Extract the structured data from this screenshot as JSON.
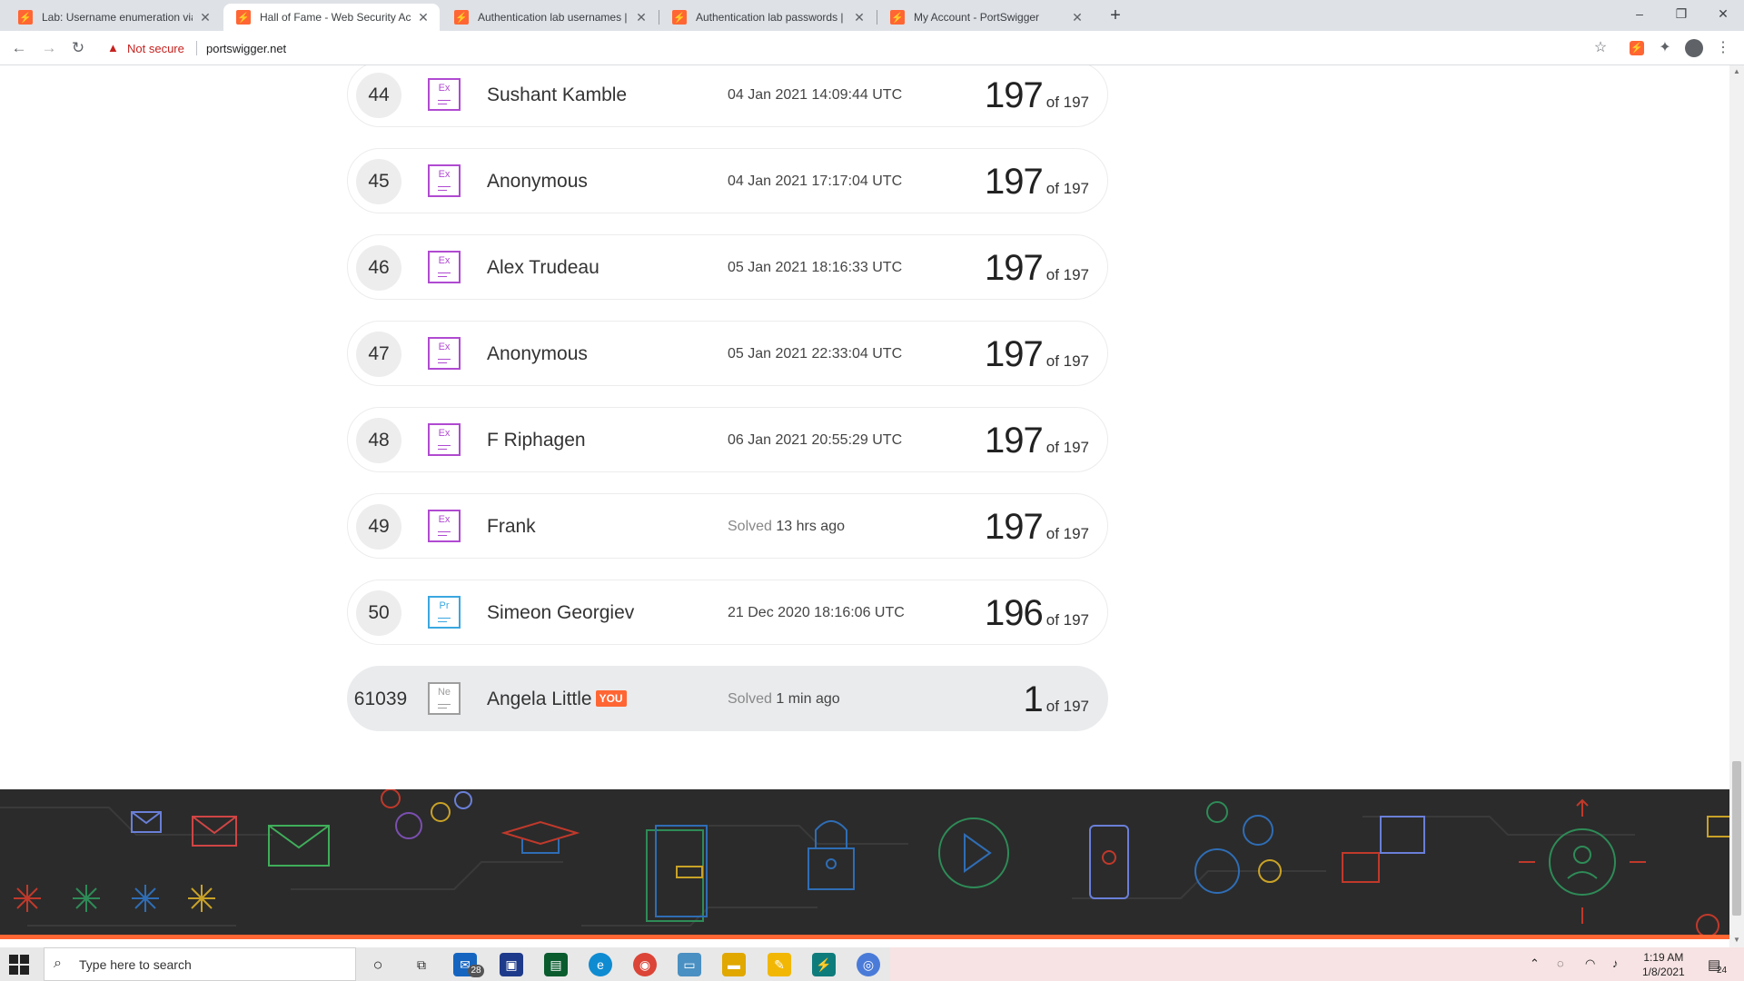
{
  "browser": {
    "tabs": [
      {
        "title": "Lab: Username enumeration via d",
        "active": false
      },
      {
        "title": "Hall of Fame - Web Security Aca",
        "active": true
      },
      {
        "title": "Authentication lab usernames | W",
        "active": false
      },
      {
        "title": "Authentication lab passwords | W",
        "active": false
      },
      {
        "title": "My Account - PortSwigger",
        "active": false
      }
    ],
    "not_secure": "Not secure",
    "url": "portswigger.net"
  },
  "leaderboard": {
    "rows": [
      {
        "rank": "44",
        "badge": "Ex",
        "name": "Sushant Kamble",
        "date": "04 Jan 2021 14:09:44 UTC",
        "solved": "197",
        "of": "of 197"
      },
      {
        "rank": "45",
        "badge": "Ex",
        "name": "Anonymous",
        "date": "04 Jan 2021 17:17:04 UTC",
        "solved": "197",
        "of": "of 197"
      },
      {
        "rank": "46",
        "badge": "Ex",
        "name": "Alex Trudeau",
        "date": "05 Jan 2021 18:16:33 UTC",
        "solved": "197",
        "of": "of 197"
      },
      {
        "rank": "47",
        "badge": "Ex",
        "name": "Anonymous",
        "date": "05 Jan 2021 22:33:04 UTC",
        "solved": "197",
        "of": "of 197"
      },
      {
        "rank": "48",
        "badge": "Ex",
        "name": "F Riphagen",
        "date": "06 Jan 2021 20:55:29 UTC",
        "solved": "197",
        "of": "of 197"
      },
      {
        "rank": "49",
        "badge": "Ex",
        "name": "Frank",
        "date_prefix": "Solved",
        "date": "13 hrs ago",
        "solved": "197",
        "of": "of 197"
      },
      {
        "rank": "50",
        "badge": "Pr",
        "name": "Simeon Georgiev",
        "date": "21 Dec 2020 18:16:06 UTC",
        "solved": "196",
        "of": "of 197"
      }
    ],
    "me": {
      "rank": "61039",
      "badge": "Ne",
      "name": "Angela Little",
      "you": "YOU",
      "date_prefix": "Solved",
      "date": "1 min ago",
      "solved": "1",
      "of": "of 197"
    }
  },
  "colors": {
    "brand": "#ff6633",
    "expert": "#b04ad1",
    "practitioner": "#3aa7e0",
    "newcomer": "#9e9e9e"
  },
  "taskbar": {
    "search_placeholder": "Type here to search",
    "mail_badge": "28",
    "time": "1:19 AM",
    "date": "1/8/2021",
    "notif_count": "24"
  }
}
